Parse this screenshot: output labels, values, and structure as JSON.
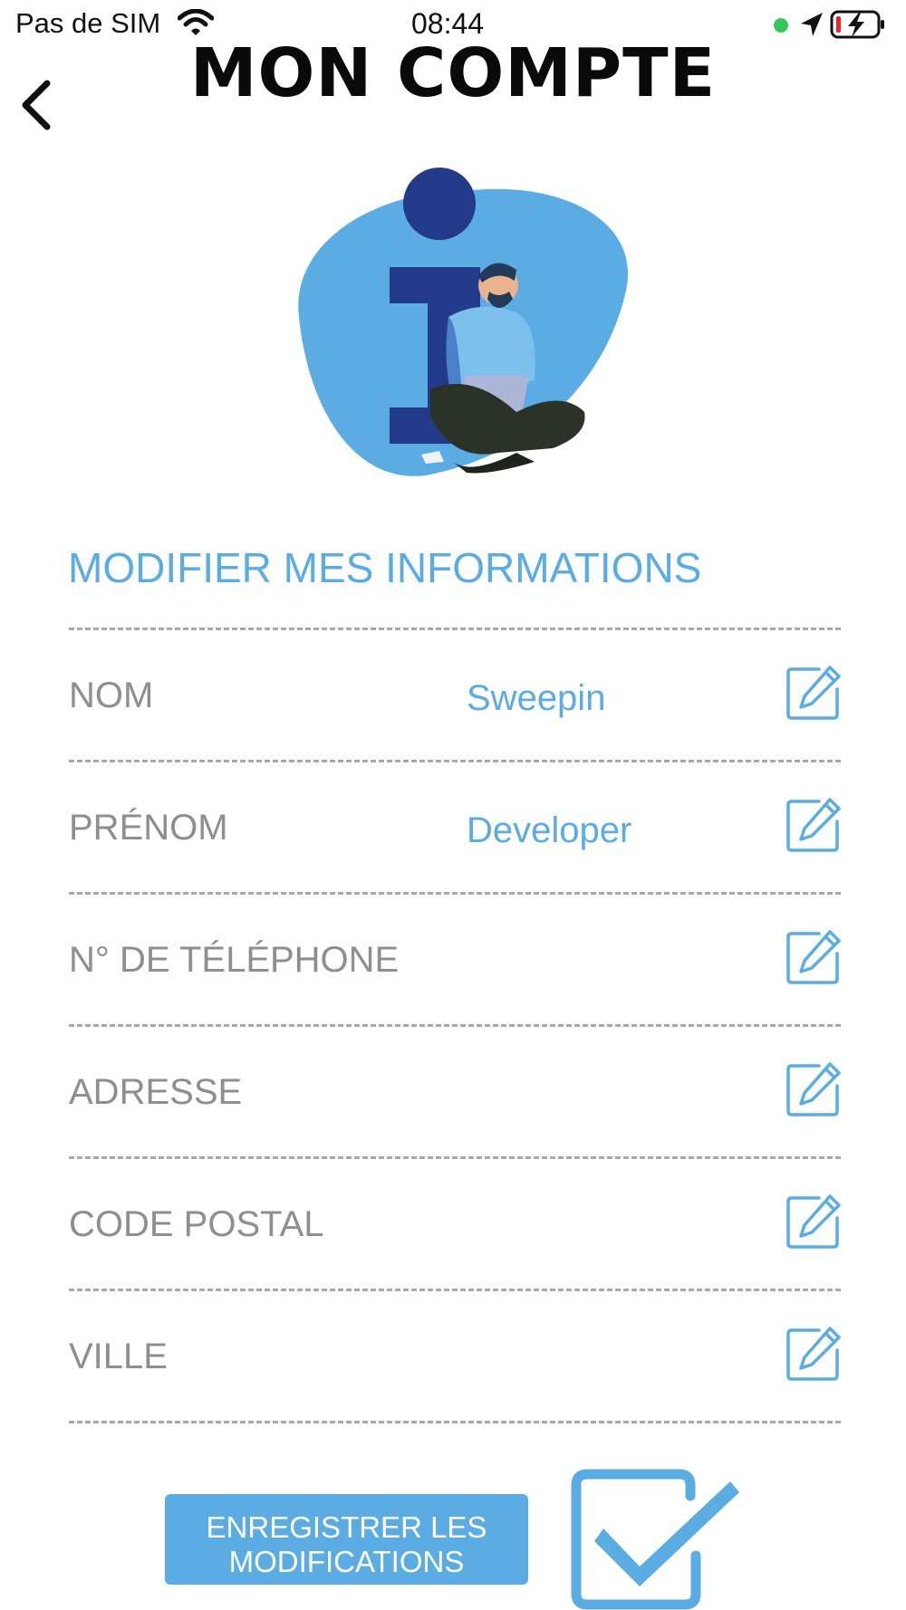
{
  "status_bar": {
    "carrier": "Pas de SIM",
    "time": "08:44"
  },
  "header": {
    "title": "MON COMPTE",
    "back_icon": "chevron-left-icon"
  },
  "section": {
    "title": "MODIFIER MES INFORMATIONS"
  },
  "fields": [
    {
      "label": "NOM",
      "value": "Sweepin",
      "icon": "edit-icon"
    },
    {
      "label": "PRÉNOM",
      "value": "Developer",
      "icon": "edit-icon"
    },
    {
      "label": "N° DE TÉLÉPHONE",
      "value": "",
      "icon": "edit-icon"
    },
    {
      "label": "ADRESSE",
      "value": "",
      "icon": "edit-icon"
    },
    {
      "label": "CODE POSTAL",
      "value": "",
      "icon": "edit-icon"
    },
    {
      "label": "VILLE",
      "value": "",
      "icon": "edit-icon"
    }
  ],
  "actions": {
    "save_label_line1": "ENREGISTRER LES",
    "save_label_line2": "MODIFICATIONS",
    "confirm_icon": "checkbox-check-icon"
  },
  "colors": {
    "accent": "#5aace3",
    "label_gray": "#8e8e8e",
    "navy": "#233a8b"
  }
}
